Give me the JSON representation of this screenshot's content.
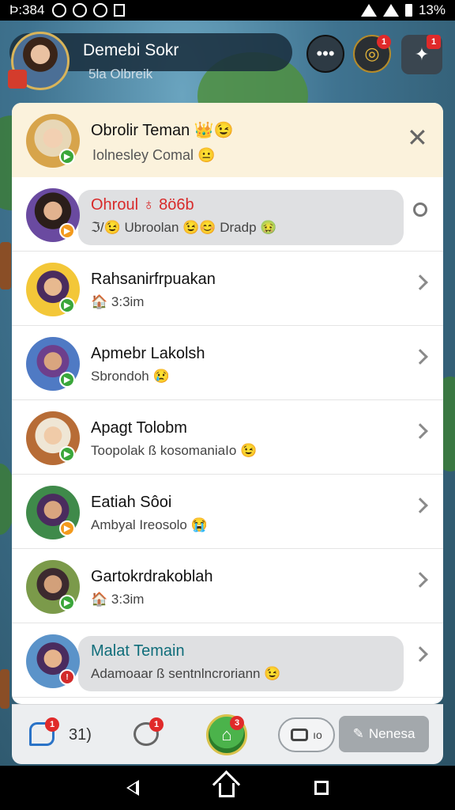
{
  "status_bar": {
    "time": "Þ:384",
    "battery": "13%"
  },
  "header": {
    "title": "Demebi Sokr",
    "subtitle": "5la Olbreik",
    "notification_count": "1",
    "menu_badge": "1"
  },
  "panel_top": {
    "title": "Obrolir Teman",
    "title_emoji": "👑😉",
    "subtitle": "Iolnesley Comal",
    "subtitle_emoji": "😐"
  },
  "chats": [
    {
      "name": "Ohroul ♁ 8ö6b",
      "message": "ℑ/😉 Ubroolan 😉😊 Dradp 🤢",
      "highlighted": true,
      "name_color": "#d82a2a",
      "status": "orange",
      "arrow": "ring"
    },
    {
      "name": "Rahsanirfrpuakan",
      "message": "🏠 3:3im",
      "highlighted": false,
      "status": "green",
      "arrow": "chevron"
    },
    {
      "name": "Apmebr Lakolsh",
      "message": "Sbrondoh 😢",
      "highlighted": false,
      "status": "green",
      "arrow": "chevron"
    },
    {
      "name": "Apagt Tolobm",
      "message": "Toopolak ß kosomaniaIo 😉",
      "highlighted": false,
      "status": "green",
      "arrow": "chevron"
    },
    {
      "name": "Eatiah Sôoi",
      "message": "Ambyal Ireosolo 😭",
      "highlighted": false,
      "status": "orange",
      "arrow": "chevron"
    },
    {
      "name": "Gartokrdrakoblah",
      "message": "🏠 3:3im",
      "highlighted": false,
      "status": "green",
      "arrow": "chevron"
    },
    {
      "name": "Malat Temain",
      "message": "Adamoaar ß sentnlncroriann 😉",
      "highlighted": true,
      "name_color": "#0f6d7a",
      "status": "red",
      "arrow": "chevron"
    }
  ],
  "bottom_bar": {
    "chat_badge": "1",
    "chat_count": "31)",
    "bubble_badge": "1",
    "home_badge": "3",
    "camera_label": "ıo",
    "new_button_label": "Nenesa"
  },
  "colors": {
    "accent_green": "#3aa63a",
    "status_orange": "#f39a1d",
    "status_red": "#d22a2a",
    "notif_red": "#e02a2a"
  }
}
